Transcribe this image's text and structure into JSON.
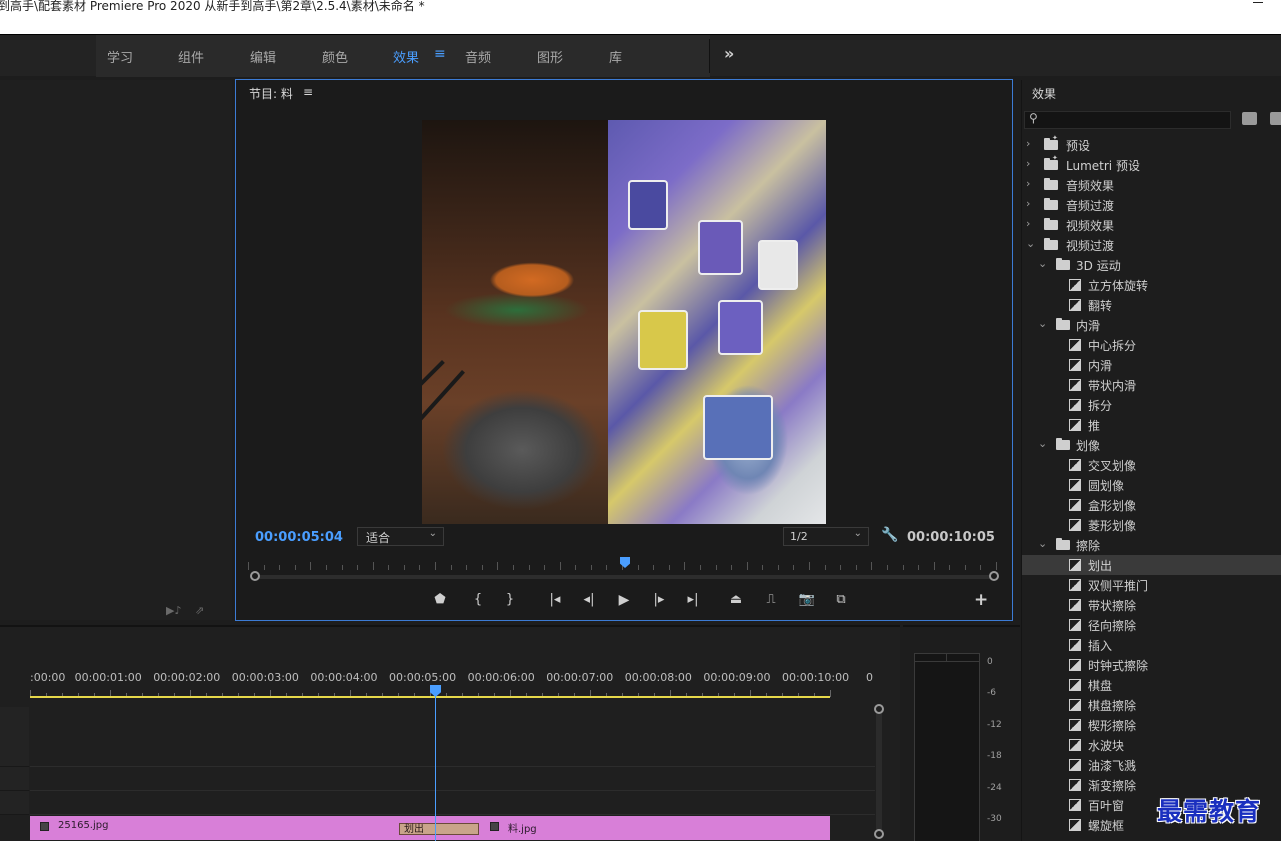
{
  "window": {
    "title": "到高手\\配套素材 Premiere Pro 2020 从新手到高手\\第2章\\2.5.4\\素材\\未命名 *"
  },
  "workspaces": {
    "tabs": [
      "学习",
      "组件",
      "编辑",
      "颜色",
      "效果",
      "音频",
      "图形",
      "库"
    ],
    "active": "效果",
    "menu_glyph": "≡",
    "more_glyph": "»"
  },
  "program_monitor": {
    "title": "节目: 料",
    "menu_glyph": "≡",
    "timecode_current": "00:00:05:04",
    "fit": "适合",
    "resolution": "1/2",
    "timecode_duration": "00:00:10:05",
    "add_glyph": "+"
  },
  "timeline": {
    "ruler_labels": [
      ":00:00",
      "00:00:01:00",
      "00:00:02:00",
      "00:00:03:00",
      "00:00:04:00",
      "00:00:05:00",
      "00:00:06:00",
      "00:00:07:00",
      "00:00:08:00",
      "00:00:09:00",
      "00:00:10:00",
      "0"
    ],
    "clips": [
      {
        "name": "25165.jpg"
      },
      {
        "name": "料.jpg"
      }
    ],
    "transition": "划出",
    "playhead_time": "00:00:05:04"
  },
  "audio_meter": {
    "db_labels": [
      "0",
      "-6",
      "-12",
      "-18",
      "-24",
      "-30"
    ]
  },
  "effects_panel": {
    "title": "效果",
    "search_value": "",
    "tree": [
      {
        "label": "预设",
        "type": "folder-star",
        "level": 0,
        "expanded": false
      },
      {
        "label": "Lumetri 预设",
        "type": "folder-star",
        "level": 0,
        "expanded": false
      },
      {
        "label": "音频效果",
        "type": "folder",
        "level": 0,
        "expanded": false
      },
      {
        "label": "音频过渡",
        "type": "folder",
        "level": 0,
        "expanded": false
      },
      {
        "label": "视频效果",
        "type": "folder",
        "level": 0,
        "expanded": false
      },
      {
        "label": "视频过渡",
        "type": "folder",
        "level": 0,
        "expanded": true
      },
      {
        "label": "3D 运动",
        "type": "folder",
        "level": 1,
        "expanded": true
      },
      {
        "label": "立方体旋转",
        "type": "transition",
        "level": 2
      },
      {
        "label": "翻转",
        "type": "transition",
        "level": 2
      },
      {
        "label": "内滑",
        "type": "folder",
        "level": 1,
        "expanded": true
      },
      {
        "label": "中心拆分",
        "type": "transition",
        "level": 2
      },
      {
        "label": "内滑",
        "type": "transition",
        "level": 2
      },
      {
        "label": "带状内滑",
        "type": "transition",
        "level": 2
      },
      {
        "label": "拆分",
        "type": "transition",
        "level": 2
      },
      {
        "label": "推",
        "type": "transition",
        "level": 2
      },
      {
        "label": "划像",
        "type": "folder",
        "level": 1,
        "expanded": true
      },
      {
        "label": "交叉划像",
        "type": "transition",
        "level": 2
      },
      {
        "label": "圆划像",
        "type": "transition",
        "level": 2
      },
      {
        "label": "盒形划像",
        "type": "transition",
        "level": 2
      },
      {
        "label": "菱形划像",
        "type": "transition",
        "level": 2
      },
      {
        "label": "擦除",
        "type": "folder",
        "level": 1,
        "expanded": true
      },
      {
        "label": "划出",
        "type": "transition",
        "level": 2,
        "selected": true
      },
      {
        "label": "双侧平推门",
        "type": "transition",
        "level": 2
      },
      {
        "label": "带状擦除",
        "type": "transition",
        "level": 2
      },
      {
        "label": "径向擦除",
        "type": "transition",
        "level": 2
      },
      {
        "label": "插入",
        "type": "transition",
        "level": 2
      },
      {
        "label": "时钟式擦除",
        "type": "transition",
        "level": 2
      },
      {
        "label": "棋盘",
        "type": "transition",
        "level": 2
      },
      {
        "label": "棋盘擦除",
        "type": "transition",
        "level": 2
      },
      {
        "label": "楔形擦除",
        "type": "transition",
        "level": 2
      },
      {
        "label": "水波块",
        "type": "transition",
        "level": 2
      },
      {
        "label": "油漆飞溅",
        "type": "transition",
        "level": 2
      },
      {
        "label": "渐变擦除",
        "type": "transition",
        "level": 2
      },
      {
        "label": "百叶窗",
        "type": "transition",
        "level": 2
      },
      {
        "label": "螺旋框",
        "type": "transition",
        "level": 2
      }
    ]
  },
  "watermark": "最需教育",
  "colors": {
    "accent": "#4a9eff",
    "clip": "#d87fd8",
    "work_area": "#e6d84a"
  }
}
